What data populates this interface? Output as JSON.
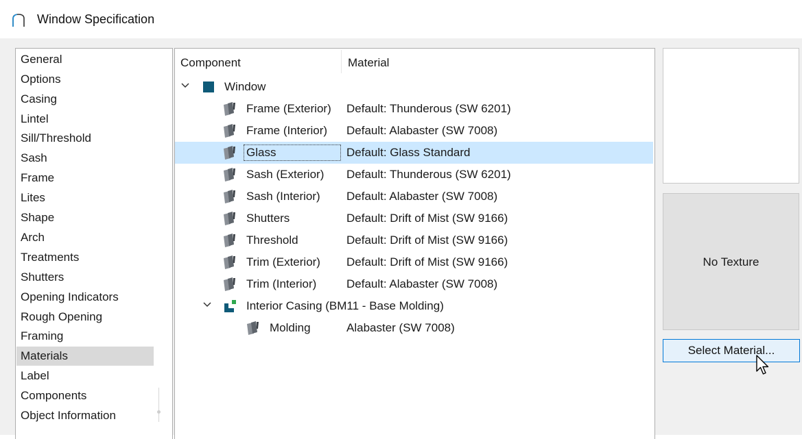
{
  "window": {
    "title": "Window Specification"
  },
  "categories": [
    "General",
    "Options",
    "Casing",
    "Lintel",
    "Sill/Threshold",
    "Sash",
    "Frame",
    "Lites",
    "Shape",
    "Arch",
    "Treatments",
    "Shutters",
    "Opening Indicators",
    "Rough Opening",
    "Framing",
    "Materials",
    "Label",
    "Components",
    "Object Information"
  ],
  "selected_category": "Materials",
  "table": {
    "headers": {
      "component": "Component",
      "material": "Material"
    },
    "rows": [
      {
        "component": "Window",
        "material": "",
        "level": 0,
        "expanded": true,
        "icon": "blue-square-icon"
      },
      {
        "component": "Frame (Exterior)",
        "material": "Default: Thunderous (SW 6201)",
        "level": 1,
        "icon": "material-swatch-icon"
      },
      {
        "component": "Frame (Interior)",
        "material": "Default: Alabaster (SW 7008)",
        "level": 1,
        "icon": "material-swatch-icon"
      },
      {
        "component": "Glass",
        "material": "Default: Glass  Standard",
        "level": 1,
        "icon": "material-swatch-icon",
        "selected": true
      },
      {
        "component": "Sash (Exterior)",
        "material": "Default: Thunderous (SW 6201)",
        "level": 1,
        "icon": "material-swatch-icon"
      },
      {
        "component": "Sash (Interior)",
        "material": "Default: Alabaster (SW 7008)",
        "level": 1,
        "icon": "material-swatch-icon"
      },
      {
        "component": "Shutters",
        "material": "Default: Drift of Mist (SW 9166)",
        "level": 1,
        "icon": "material-swatch-icon"
      },
      {
        "component": "Threshold",
        "material": "Default: Drift of Mist (SW 9166)",
        "level": 1,
        "icon": "material-swatch-icon"
      },
      {
        "component": "Trim (Exterior)",
        "material": "Default: Drift of Mist (SW 9166)",
        "level": 1,
        "icon": "material-swatch-icon"
      },
      {
        "component": "Trim (Interior)",
        "material": "Default: Alabaster (SW 7008)",
        "level": 1,
        "icon": "material-swatch-icon"
      },
      {
        "component": "Interior Casing (BM11 - Base Molding)",
        "material": "",
        "level": 1,
        "expanded": true,
        "icon": "casing-icon"
      },
      {
        "component": "Molding",
        "material": "Alabaster (SW 7008)",
        "level": 2,
        "icon": "material-swatch-icon"
      }
    ]
  },
  "texture": {
    "label": "No Texture"
  },
  "buttons": {
    "select_material": "Select Material..."
  },
  "colors": {
    "selection": "#cce8ff",
    "category_selection": "#d9d9d9",
    "window_icon": "#0f5a78",
    "button_border": "#0078d7"
  }
}
